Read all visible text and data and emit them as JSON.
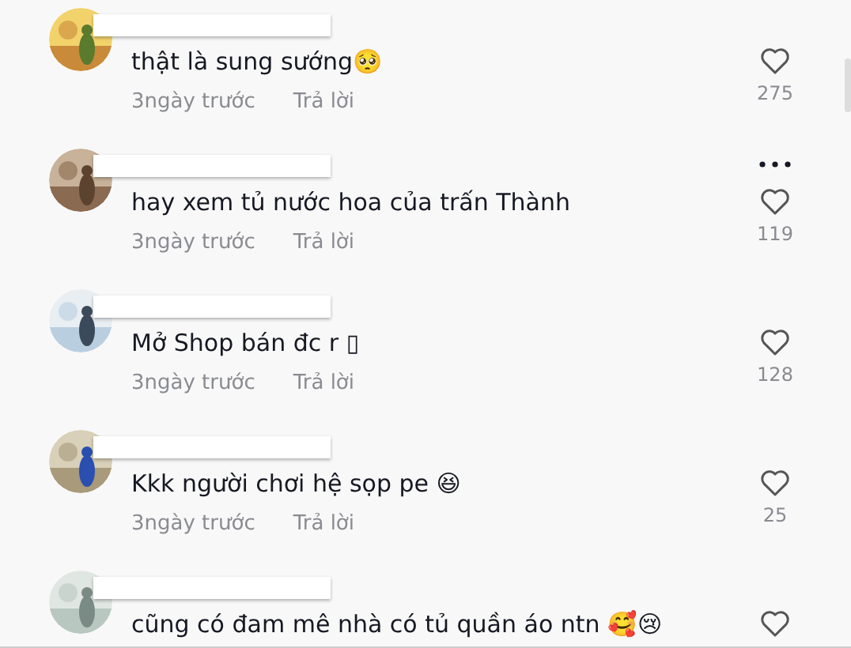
{
  "comments": [
    {
      "text": "thật là sung sướng🥺",
      "time": "3ngày trước",
      "reply": "Trả lời",
      "likes": "275",
      "more": false
    },
    {
      "text": "hay xem tủ nước hoa của trấn Thành",
      "time": "3ngày trước",
      "reply": "Trả lời",
      "likes": "119",
      "more": true
    },
    {
      "text": "Mở Shop bán đc r ▯",
      "time": "3ngày trước",
      "reply": "Trả lời",
      "likes": "128",
      "more": false
    },
    {
      "text": "Kkk người chơi hệ sọp pe 😆",
      "time": "3ngày trước",
      "reply": "Trả lời",
      "likes": "25",
      "more": false
    },
    {
      "text": "cũng có đam mê nhà có tủ quần áo ntn 🥰😢",
      "more": false
    }
  ]
}
